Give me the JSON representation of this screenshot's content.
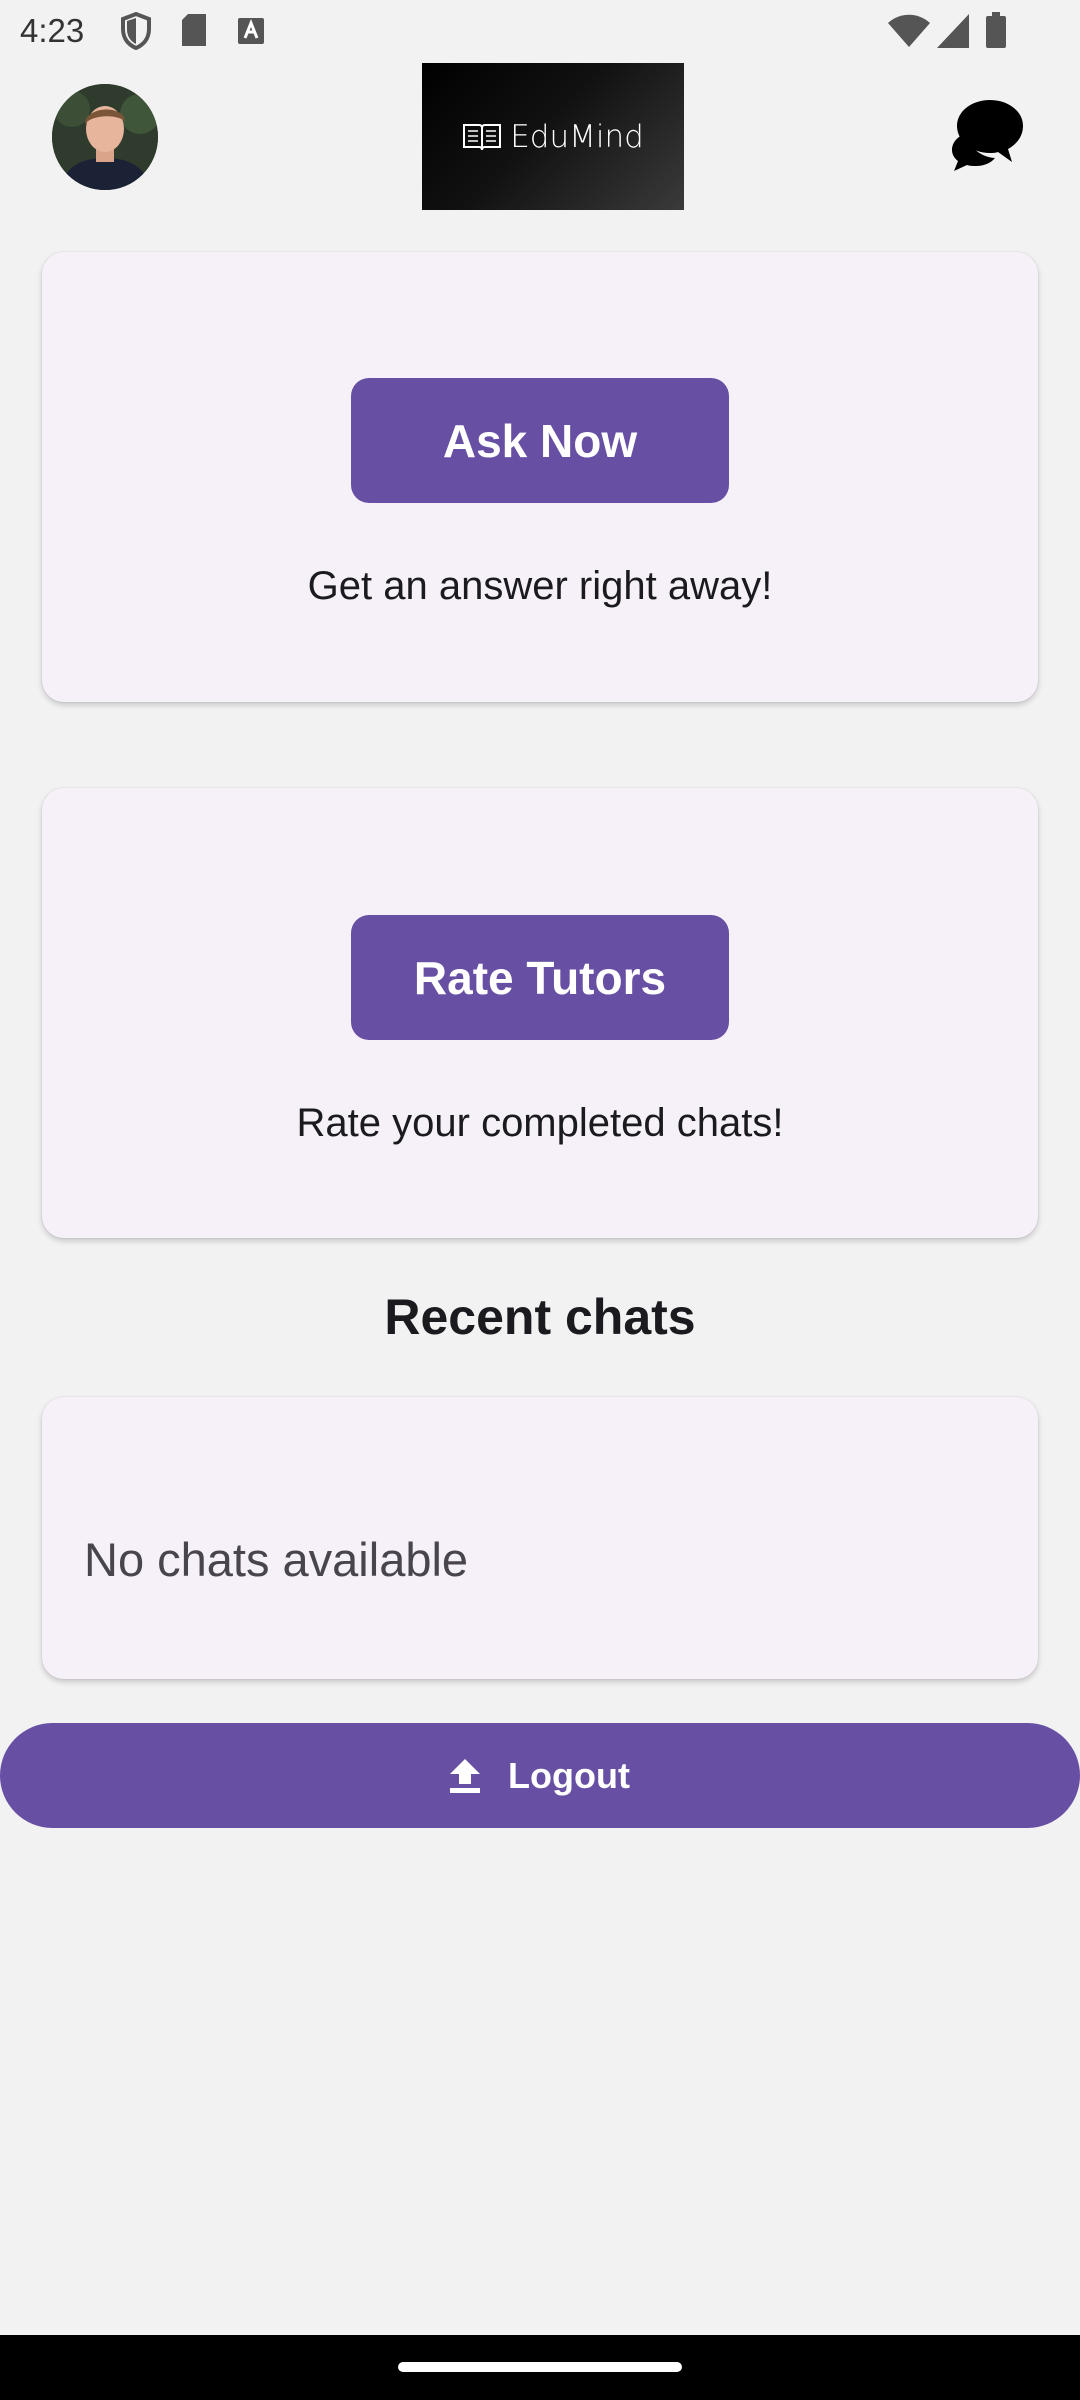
{
  "status_bar": {
    "time": "4:23",
    "icons": [
      "shield-icon",
      "sd-card-icon",
      "font-icon",
      "wifi-icon",
      "signal-icon",
      "battery-icon"
    ]
  },
  "header": {
    "logo_text": "EduMind",
    "avatar": "profile-avatar",
    "chat_icon": "chat-bubbles-icon"
  },
  "cards": {
    "ask": {
      "button": "Ask Now",
      "caption": "Get an answer right away!"
    },
    "rate": {
      "button": "Rate Tutors",
      "caption": "Rate your completed chats!"
    }
  },
  "recent": {
    "title": "Recent chats",
    "empty": "No chats available"
  },
  "logout": {
    "label": "Logout",
    "icon": "upload-icon"
  },
  "colors": {
    "primary": "#6750a4",
    "card_bg": "#f6f1f8",
    "page_bg": "#f2f2f2"
  }
}
